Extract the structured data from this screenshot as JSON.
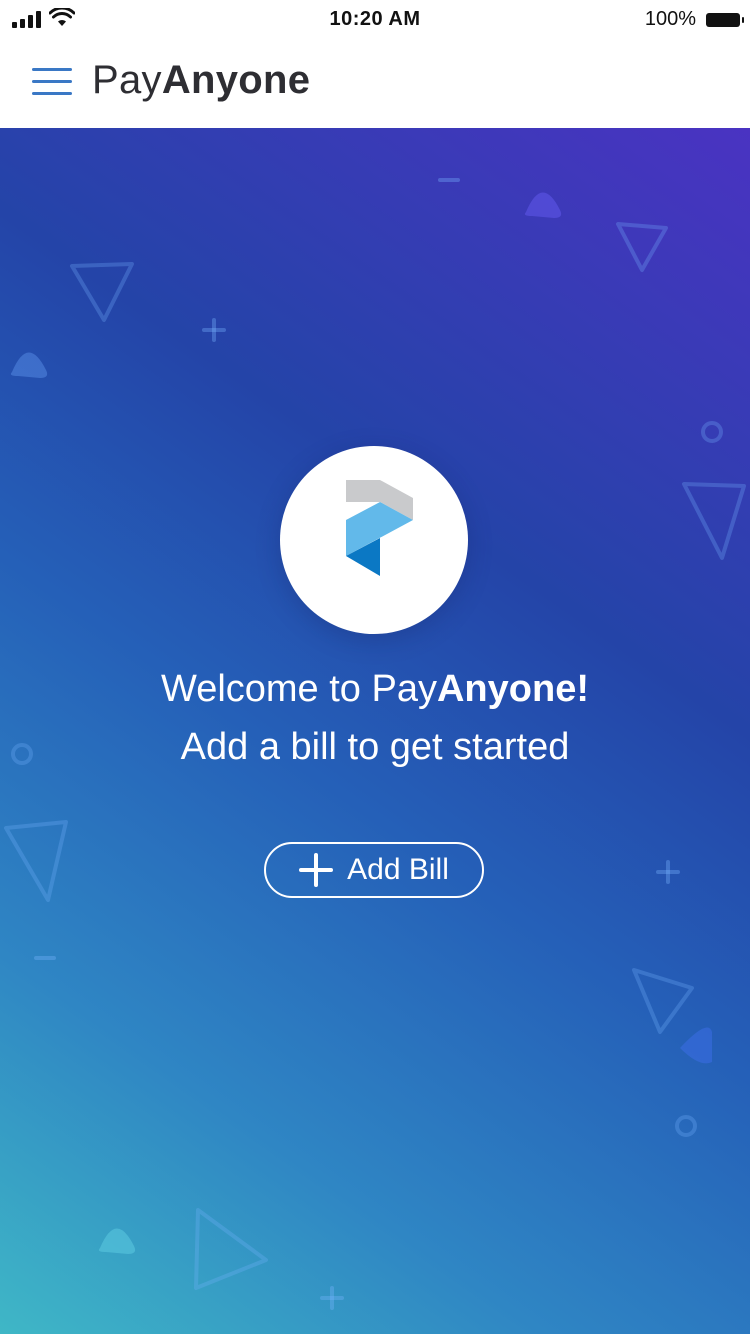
{
  "status_bar": {
    "time": "10:20 AM",
    "battery_text": "100%"
  },
  "header": {
    "brand_light": "Pay",
    "brand_bold": "Anyone"
  },
  "hero": {
    "welcome_prefix": "Welcome to Pay",
    "welcome_bold": "Anyone!",
    "subtitle": "Add a bill to get started",
    "add_bill_label": "Add Bill"
  },
  "colors": {
    "menu_icon": "#3a78c5",
    "gradient_start": "#3fb7c6",
    "gradient_end": "#4a33c2",
    "logo_gray": "#c9cacc",
    "logo_light_blue": "#62b9ea",
    "logo_dark_blue": "#0b78c4"
  },
  "icons": {
    "menu": "hamburger-icon",
    "add": "plus-icon",
    "signal": "cellular-signal-icon",
    "wifi": "wifi-icon",
    "battery": "battery-icon"
  }
}
